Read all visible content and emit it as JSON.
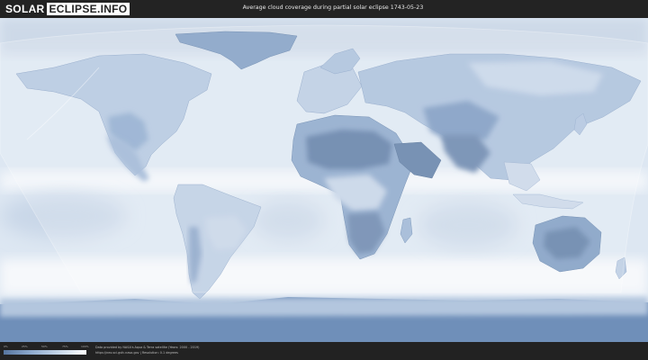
{
  "header": {
    "logo_part1": "SOLAR",
    "logo_part2": "ECLIPSE.INFO",
    "title": "Average cloud coverage during partial solar eclipse 1743-05-23"
  },
  "legend": {
    "ticks": [
      "0%",
      "25%",
      "50%",
      "75%",
      "100%"
    ],
    "colors": [
      "#56759f",
      "#8eaace",
      "#c6d6e8",
      "#ffffff"
    ]
  },
  "footer": {
    "credit_line1": "Data provided by NASA's Aqua & Terra satellite (Years: 2000 - 2019)",
    "credit_line2": "https://neo.sci.gsfc.nasa.gov | Resolution: 0.1 degrees"
  },
  "map": {
    "projection": "equirectangular",
    "cloud_colors": {
      "clear": "#56759f",
      "partial": "#a9c0db",
      "overcast": "#f4f7fb"
    },
    "eclipse_overlay_color": "#ffffff"
  }
}
